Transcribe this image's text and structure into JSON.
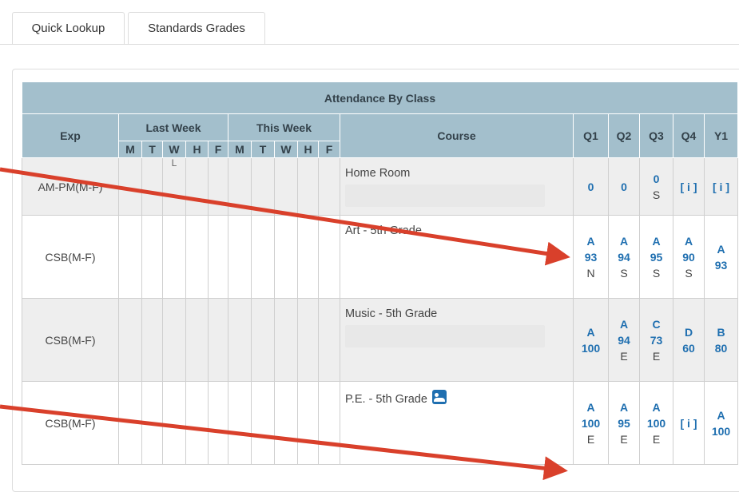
{
  "tabs": [
    {
      "label": "Quick Lookup",
      "active": true
    },
    {
      "label": "Standards Grades",
      "active": false
    }
  ],
  "table": {
    "title": "Attendance By Class",
    "headers": {
      "exp": "Exp",
      "last_week": "Last Week",
      "this_week": "This Week",
      "course": "Course",
      "terms": [
        "Q1",
        "Q2",
        "Q3",
        "Q4",
        "Y1"
      ],
      "days": [
        "M",
        "T",
        "W",
        "H",
        "F",
        "M",
        "T",
        "W",
        "H",
        "F"
      ]
    },
    "rows": [
      {
        "exp": "AM-PM(M-F)",
        "course": "Home Room",
        "attendance_mark": "L",
        "q1": {
          "line1": "0"
        },
        "q2": {
          "line1": "0"
        },
        "q3": {
          "line1": "0",
          "comment": "S"
        },
        "q4": {
          "link": "[ i ]"
        },
        "y1": {
          "link": "[ i ]"
        }
      },
      {
        "exp": "CSB(M-F)",
        "course": "Art - 5th Grade",
        "q1": {
          "letter": "A",
          "pct": "93",
          "comment": "N"
        },
        "q2": {
          "letter": "A",
          "pct": "94",
          "comment": "S"
        },
        "q3": {
          "letter": "A",
          "pct": "95",
          "comment": "S"
        },
        "q4": {
          "letter": "A",
          "pct": "90",
          "comment": "S"
        },
        "y1": {
          "letter": "A",
          "pct": "93"
        }
      },
      {
        "exp": "CSB(M-F)",
        "course": "Music - 5th Grade",
        "q1": {
          "letter": "A",
          "pct": "100"
        },
        "q2": {
          "letter": "A",
          "pct": "94",
          "comment": "E"
        },
        "q3": {
          "letter": "C",
          "pct": "73",
          "comment": "E"
        },
        "q4": {
          "letter": "D",
          "pct": "60"
        },
        "y1": {
          "letter": "B",
          "pct": "80"
        }
      },
      {
        "exp": "CSB(M-F)",
        "course": "P.E. - 5th Grade",
        "course_icon": "contacts-icon",
        "q1": {
          "letter": "A",
          "pct": "100",
          "comment": "E"
        },
        "q2": {
          "letter": "A",
          "pct": "95",
          "comment": "E"
        },
        "q3": {
          "letter": "A",
          "pct": "100",
          "comment": "E"
        },
        "q4": {
          "link": "[ i ]"
        },
        "y1": {
          "letter": "A",
          "pct": "100"
        }
      }
    ]
  },
  "colors": {
    "header_bg": "#a3bfcc",
    "link_blue": "#1f6fb0",
    "arrow_red": "#d9402b"
  }
}
